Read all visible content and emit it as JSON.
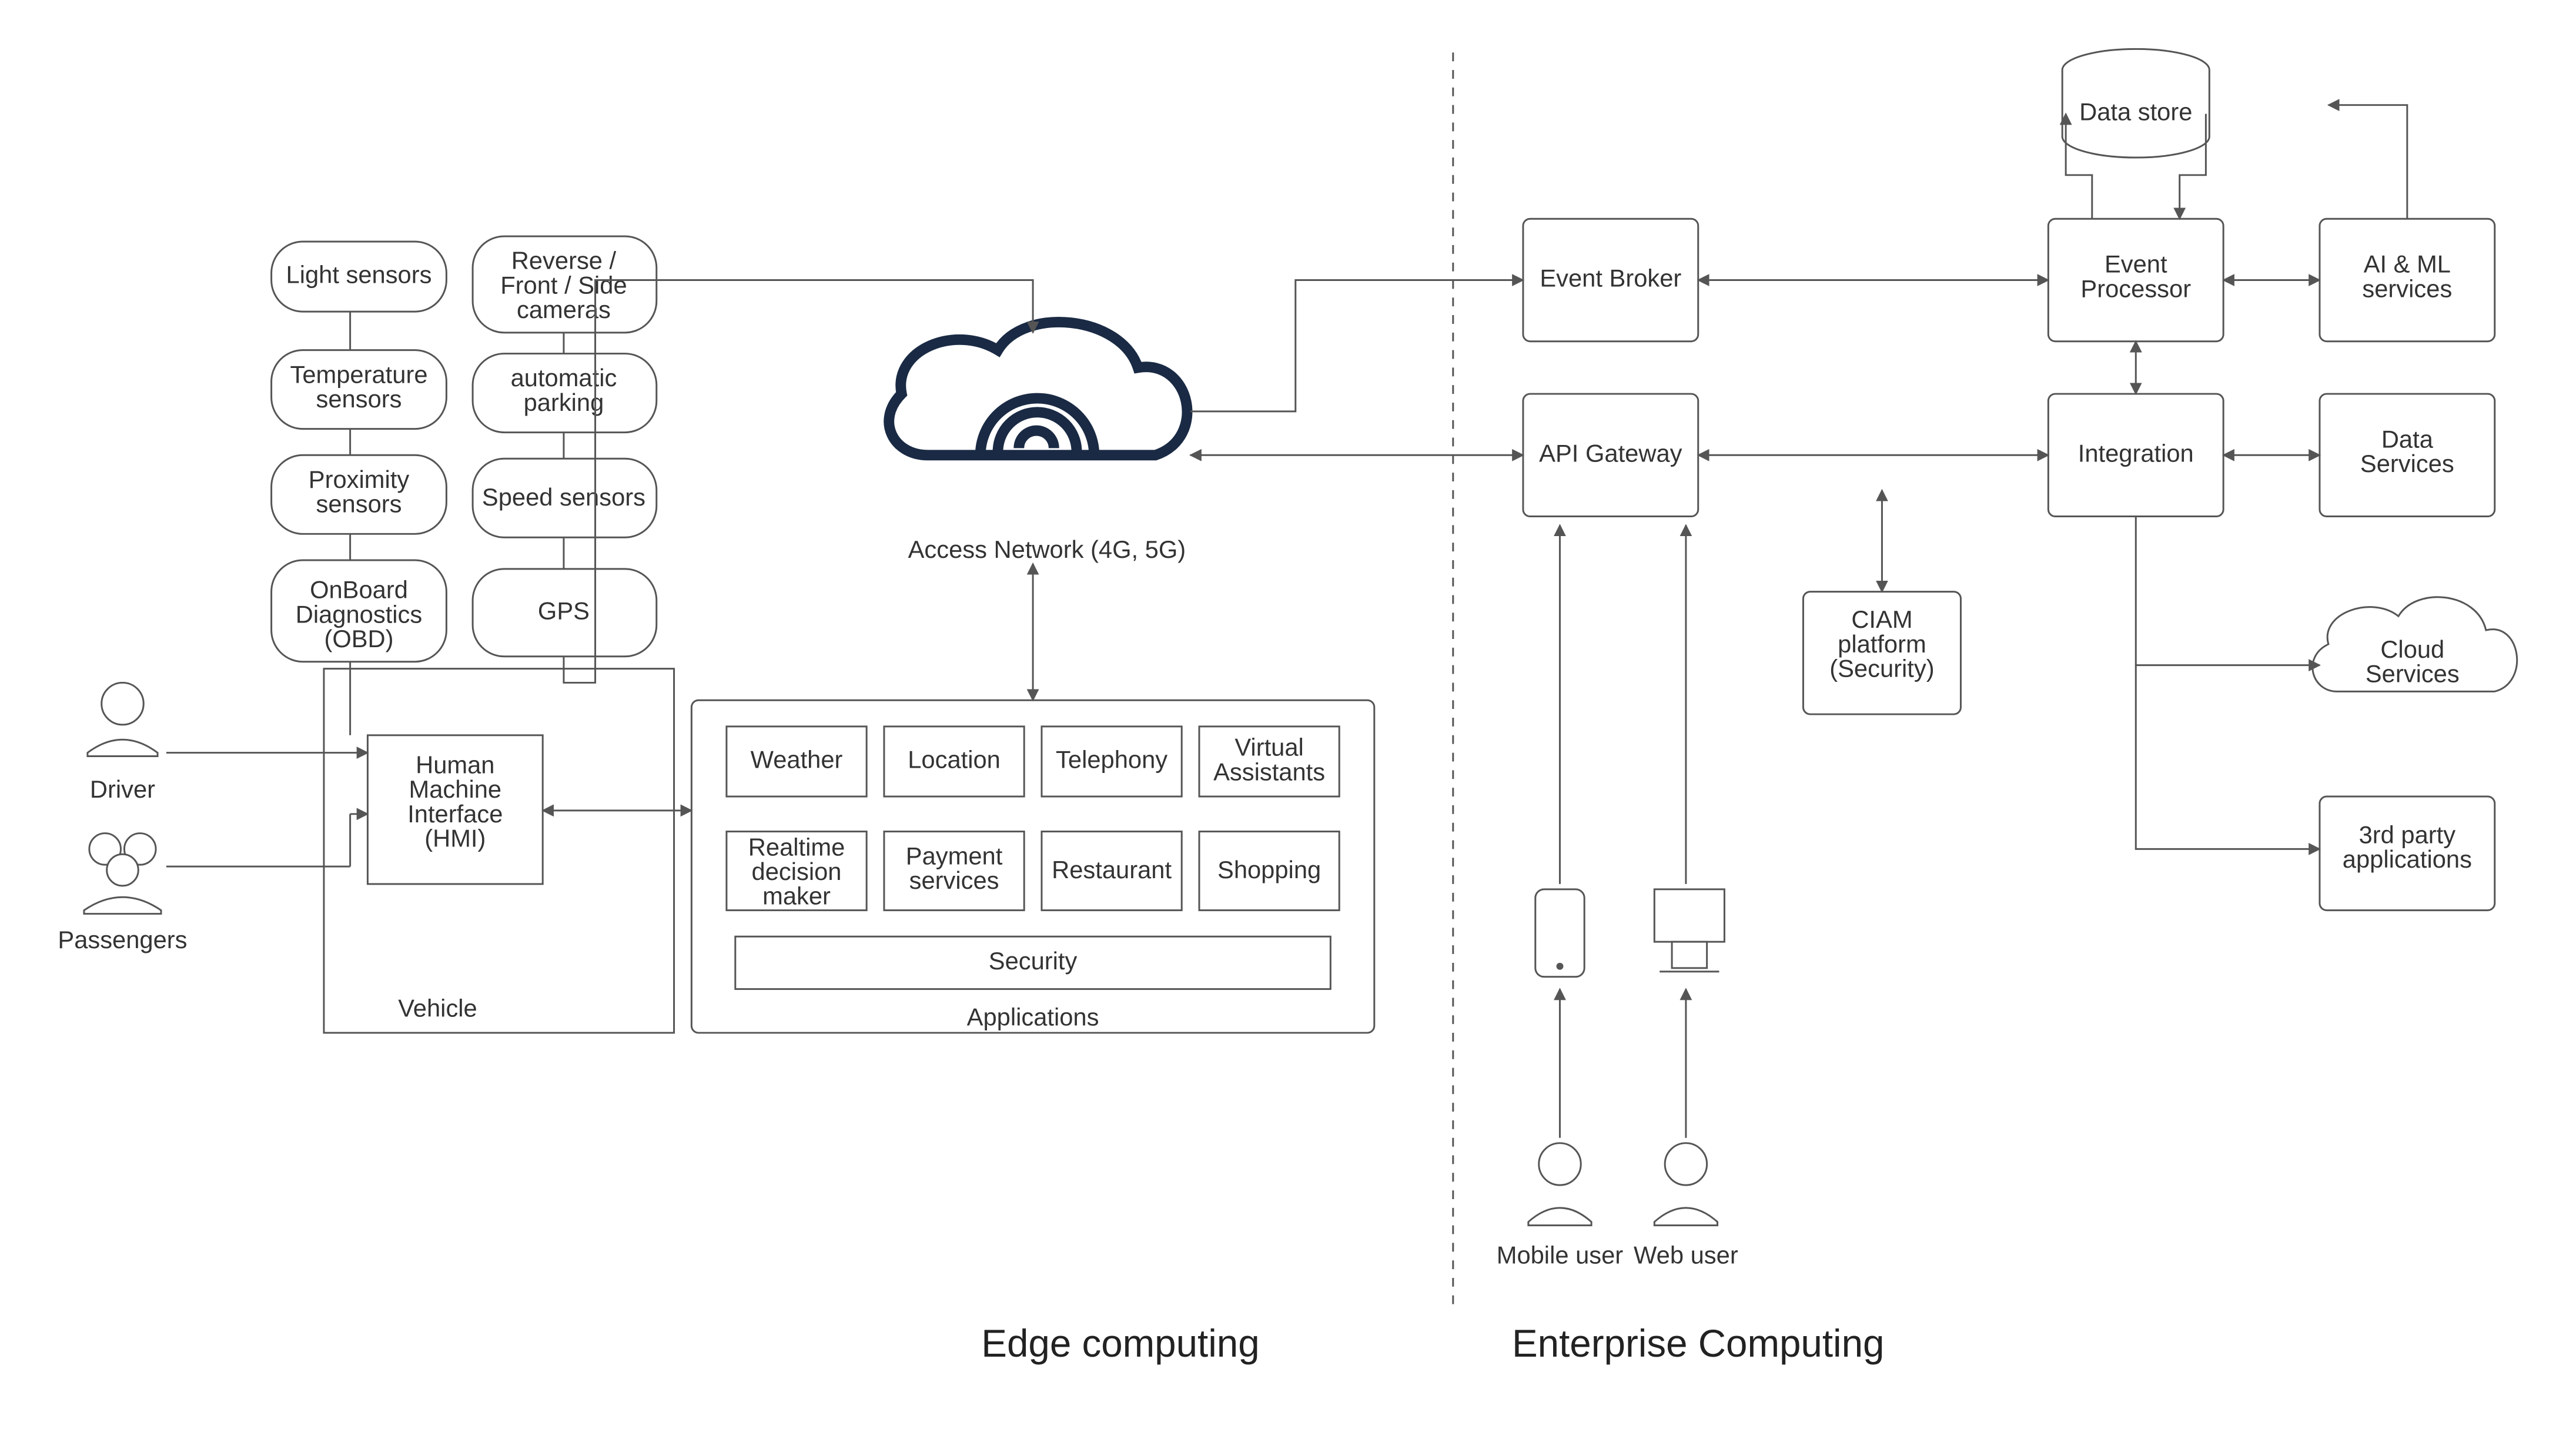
{
  "actors": {
    "driver": "Driver",
    "passengers": "Passengers",
    "mobile_user": "Mobile user",
    "web_user": "Web user"
  },
  "vehicle": {
    "label": "Vehicle",
    "sensors_left": [
      "Light sensors",
      "Temperature sensors",
      "Proximity sensors",
      "OnBoard Diagnostics (OBD)"
    ],
    "sensors_right": [
      "Reverse / Front / Side cameras",
      "automatic parking",
      "Speed sensors",
      "GPS"
    ],
    "hmi": "Human Machine Interface (HMI)"
  },
  "access_network": "Access Network (4G, 5G)",
  "applications": {
    "label": "Applications",
    "apps": [
      "Weather",
      "Location",
      "Telephony",
      "Virtual Assistants",
      "Realtime decision maker",
      "Payment services",
      "Restaurant",
      "Shopping"
    ],
    "security": "Security"
  },
  "enterprise": {
    "event_broker": "Event Broker",
    "api_gateway": "API Gateway",
    "ciam": "CIAM platform (Security)",
    "event_processor": "Event Processor",
    "integration": "Integration",
    "data_store": "Data store",
    "ai_ml": "AI & ML services",
    "data_services": "Data Services",
    "cloud_services": "Cloud Services",
    "third_party": "3rd party applications"
  },
  "sections": {
    "edge": "Edge computing",
    "enterprise": "Enterprise Computing"
  }
}
